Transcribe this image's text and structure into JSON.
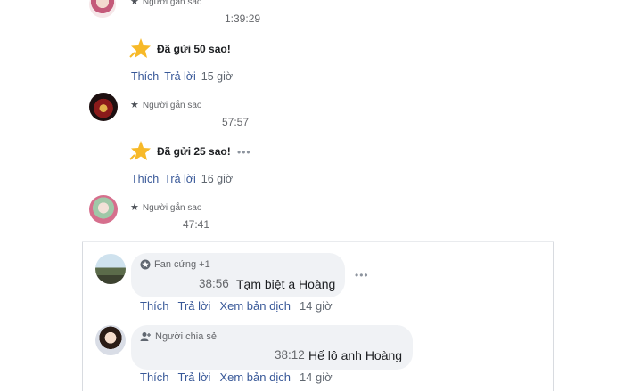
{
  "comments": [
    {
      "badge": "Người gắn sao",
      "time": "1:39:29"
    },
    {
      "badge": "Người gắn sao",
      "time": "57:57"
    },
    {
      "badge": "Người gắn sao",
      "time": "47:41"
    }
  ],
  "stars": [
    {
      "text": "Đã gửi 50 sao!"
    },
    {
      "text": "Đã gửi 25 sao!"
    }
  ],
  "action_rows": [
    {
      "like": "Thích",
      "reply": "Trả lời",
      "ago": "15 giờ"
    },
    {
      "like": "Thích",
      "reply": "Trả lời",
      "ago": "16 giờ"
    }
  ],
  "bottom_comments": [
    {
      "badge": "Fan cứng +1",
      "time": "38:56",
      "text": "Tạm biệt a Hoàng",
      "like": "Thích",
      "reply": "Trả lời",
      "translate": "Xem bản dịch",
      "ago": "14 giờ"
    },
    {
      "badge": "Người chia sẻ",
      "time": "38:12",
      "text": "Hế lô anh Hoàng",
      "like": "Thích",
      "reply": "Trả lời",
      "translate": "Xem bản dịch",
      "ago": "14 giờ"
    }
  ],
  "more_glyph": "•••",
  "colors": {
    "link": "#385898",
    "star": "#f7b928",
    "bubble": "#f0f2f5"
  }
}
